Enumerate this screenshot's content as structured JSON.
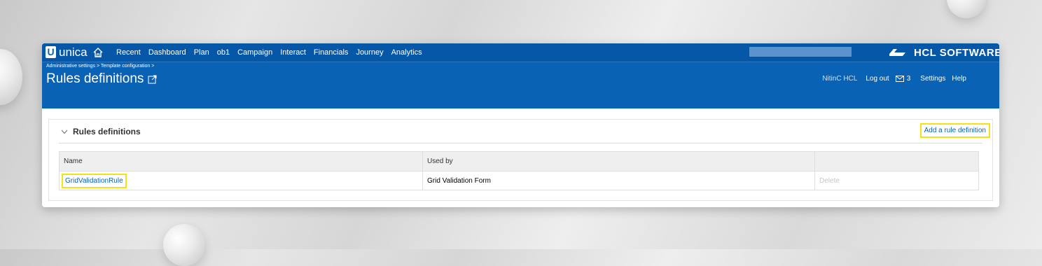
{
  "app": {
    "logo_text": "unica"
  },
  "nav": {
    "items": [
      "Recent",
      "Dashboard",
      "Plan",
      "ob1",
      "Campaign",
      "Interact",
      "Financials",
      "Journey",
      "Analytics"
    ]
  },
  "search": {
    "placeholder": ""
  },
  "brand": {
    "text": "HCL SOFTWARE"
  },
  "header": {
    "breadcrumb": "Administrative settings > Template configuration >",
    "title": "Rules definitions"
  },
  "user_bar": {
    "user": "NitinC HCL",
    "logout": "Log out",
    "mail_count": "3",
    "settings": "Settings",
    "help": "Help"
  },
  "panel": {
    "title": "Rules definitions",
    "add_label": "Add a rule definition"
  },
  "table": {
    "headers": [
      "Name",
      "Used by",
      ""
    ],
    "rows": [
      {
        "name": "GridValidationRule",
        "used_by": "Grid Validation Form",
        "action": "Delete"
      }
    ]
  },
  "colors": {
    "header_blue": "#0a62b5",
    "highlight": "#f3e21a",
    "link": "#0a62b5"
  },
  "icons": [
    "home-icon",
    "external-link-icon",
    "mail-icon",
    "chevron-down-icon",
    "hcl-logo-icon"
  ]
}
